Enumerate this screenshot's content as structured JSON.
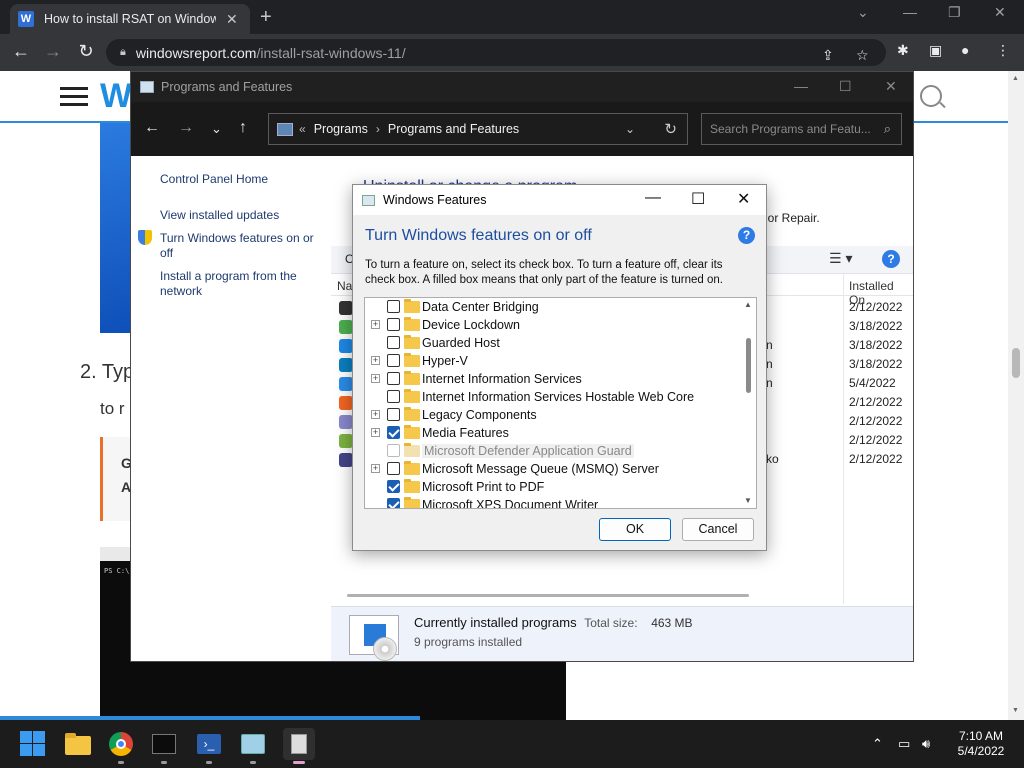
{
  "browser": {
    "tab_title": "How to install RSAT on Windows",
    "tab_favicon": "W",
    "url_domain": "windowsreport.com",
    "url_path": "/install-rsat-windows-11/"
  },
  "page": {
    "logo_letter": "W",
    "step_text": "2. Typ",
    "step_text2": "to r",
    "callout_line1": "G",
    "callout_line2": "A",
    "terminal_text": "PS C:\\"
  },
  "programs_window": {
    "title": "Programs and Features",
    "breadcrumb": [
      "Programs",
      "Programs and Features"
    ],
    "search_placeholder": "Search Programs and Featu...",
    "left_links": [
      "Control Panel Home",
      "View installed updates",
      "Turn Windows features on or off",
      "Install a program from the network"
    ],
    "heading": "Uninstall or change a program",
    "desc_fragment": ", or Repair.",
    "organize_fragment": "O",
    "col_name_fragment": "Nan",
    "col_installed": "Installed On",
    "programs": [
      {
        "color": "#333333",
        "frag": "",
        "date": "2/12/2022"
      },
      {
        "color": "#4caf50",
        "frag": "",
        "date": "3/18/2022"
      },
      {
        "color": "#1e88e5",
        "frag": "n",
        "date": "3/18/2022"
      },
      {
        "color": "#0b7fbf",
        "frag": "n",
        "date": "3/18/2022"
      },
      {
        "color": "#2b8be6",
        "frag": "n",
        "date": "5/4/2022"
      },
      {
        "color": "#f26522",
        "frag": "",
        "date": "2/12/2022"
      },
      {
        "color": "#8888cc",
        "frag": "",
        "date": "2/12/2022"
      },
      {
        "color": "#7cb342",
        "frag": "",
        "date": "2/12/2022"
      },
      {
        "color": "#444488",
        "frag": "ko",
        "date": "2/12/2022"
      }
    ],
    "details_title": "Currently installed programs",
    "total_size_label": "Total size:",
    "total_size_value": "463 MB",
    "programs_count": "9 programs installed"
  },
  "features_dialog": {
    "title": "Windows Features",
    "heading": "Turn Windows features on or off",
    "description": "To turn a feature on, select its check box. To turn a feature off, clear its check box. A filled box means that only part of the feature is turned on.",
    "features": [
      {
        "label": "Data Center Bridging",
        "expand": false,
        "checked": false,
        "disabled": false
      },
      {
        "label": "Device Lockdown",
        "expand": true,
        "checked": false,
        "disabled": false
      },
      {
        "label": "Guarded Host",
        "expand": false,
        "checked": false,
        "disabled": false
      },
      {
        "label": "Hyper-V",
        "expand": true,
        "checked": false,
        "disabled": false
      },
      {
        "label": "Internet Information Services",
        "expand": true,
        "checked": false,
        "disabled": false
      },
      {
        "label": "Internet Information Services Hostable Web Core",
        "expand": false,
        "checked": false,
        "disabled": false
      },
      {
        "label": "Legacy Components",
        "expand": true,
        "checked": false,
        "disabled": false
      },
      {
        "label": "Media Features",
        "expand": true,
        "checked": true,
        "disabled": false
      },
      {
        "label": "Microsoft Defender Application Guard",
        "expand": false,
        "checked": false,
        "disabled": true
      },
      {
        "label": "Microsoft Message Queue (MSMQ) Server",
        "expand": true,
        "checked": false,
        "disabled": false
      },
      {
        "label": "Microsoft Print to PDF",
        "expand": false,
        "checked": true,
        "disabled": false
      },
      {
        "label": "Microsoft XPS Document Writer",
        "expand": false,
        "checked": true,
        "disabled": false
      }
    ],
    "ok_label": "OK",
    "cancel_label": "Cancel"
  },
  "taskbar": {
    "time": "7:10 AM",
    "date": "5/4/2022"
  }
}
